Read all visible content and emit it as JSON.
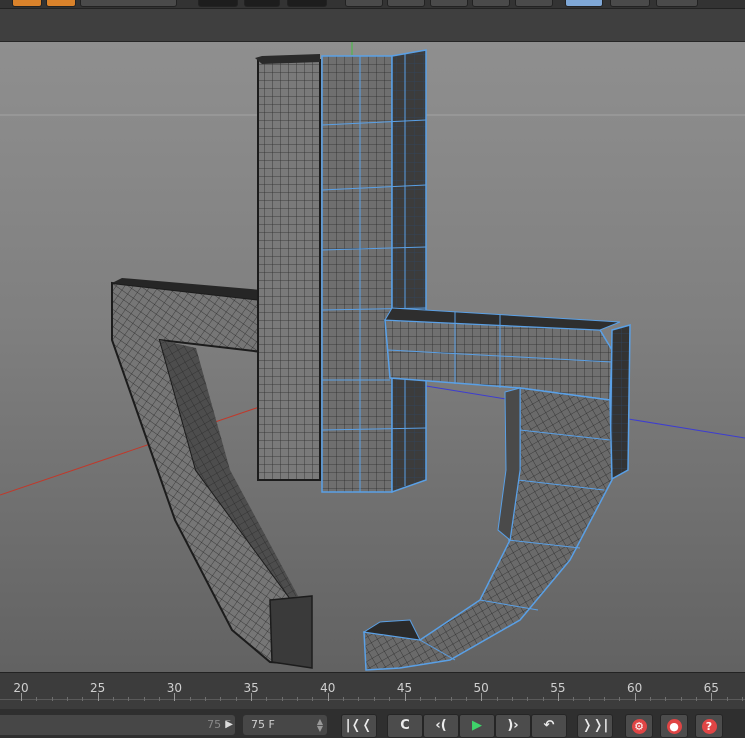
{
  "timeline": {
    "ticks": [
      "20",
      "25",
      "30",
      "35",
      "40",
      "45",
      "50",
      "55",
      "60",
      "65"
    ]
  },
  "controls": {
    "range_end": "75 F",
    "current_frame": "75 F",
    "goto_start_icon": "goto-start-icon",
    "prev_key_icon": "prev-key-icon",
    "step_back_icon": "step-back-icon",
    "play_icon": "play-icon",
    "step_forward_icon": "step-forward-icon",
    "next_key_icon": "next-key-icon",
    "goto_end_icon": "goto-end-icon",
    "record_icon": "record-key-icon",
    "autokey_icon": "auto-key-icon",
    "help_icon": "help-icon"
  },
  "colors": {
    "viewport_top": "#8f8f8f",
    "viewport_bottom": "#626262",
    "mesh_dark": "#2b2b2b",
    "selection": "#5aa0e6",
    "x_axis": "#c0392b",
    "z_axis": "#3d3dd0",
    "play": "#3fd46a"
  }
}
